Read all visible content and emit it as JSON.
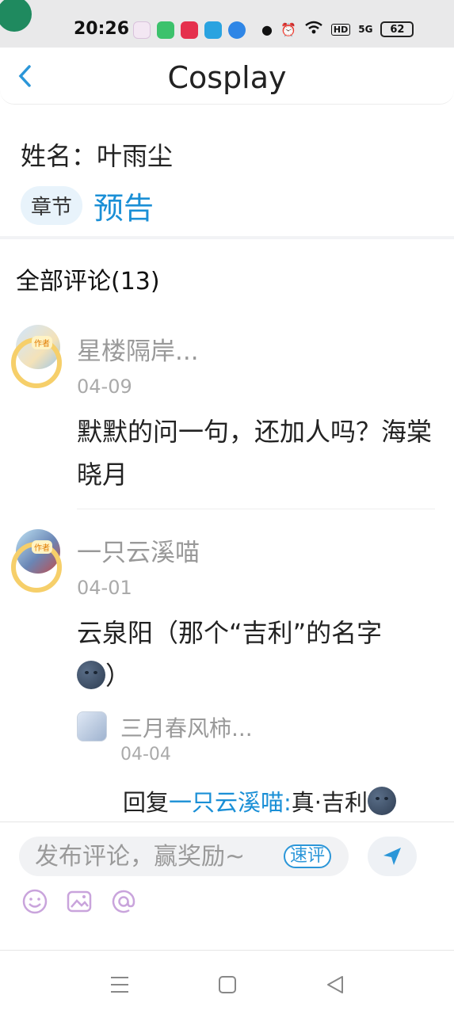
{
  "status": {
    "time": "20:26",
    "network": "5G",
    "hd": "HD",
    "battery": "62"
  },
  "header": {
    "title": "Cosplay"
  },
  "character": {
    "name_line": "姓名：叶雨尘",
    "chapter_label": "章节",
    "chapter_link": "预告"
  },
  "comments": {
    "title": "全部评论(13)",
    "items": [
      {
        "user": "星楼隔岸...",
        "date": "04-09",
        "badge": "作者",
        "text": "默默的问一句，还加人吗？海棠晓月"
      },
      {
        "user": "一只云溪喵",
        "date": "04-01",
        "badge": "作者",
        "text": "云泉阳（那个“吉利”的名字",
        "text_end": "）",
        "reply": {
          "user": "三月春风柿...",
          "date": "04-04",
          "prefix": "回复",
          "target": "一只云溪喵:",
          "text": "真·吉利"
        }
      }
    ]
  },
  "composer": {
    "placeholder": "发布评论，赢奖励~",
    "quick_label": "速评"
  },
  "colors": {
    "accent": "#1a8fd6",
    "muted": "#999999"
  }
}
